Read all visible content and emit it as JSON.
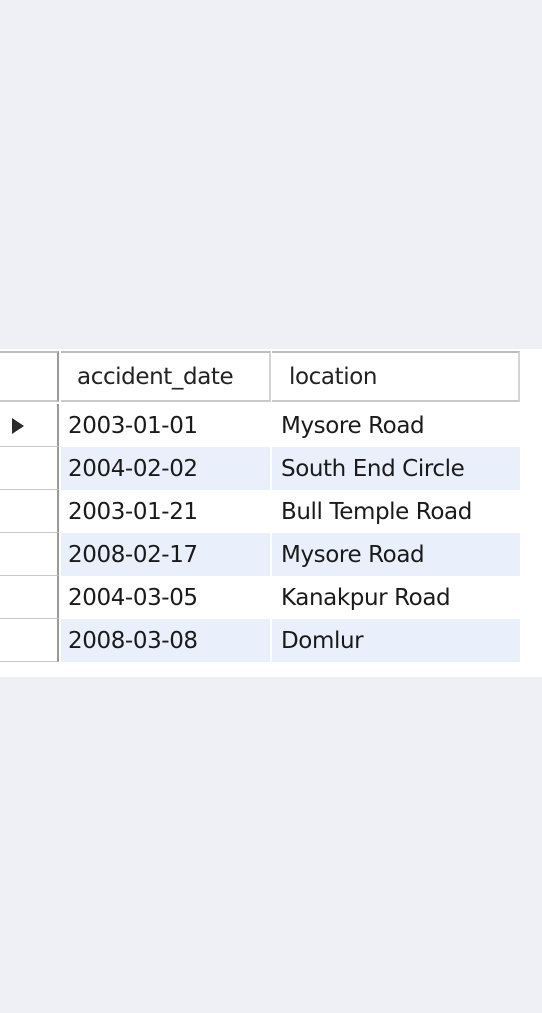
{
  "result_grid": {
    "columns": [
      "accident_date",
      "location"
    ],
    "rows": [
      {
        "accident_date": "2003-01-01",
        "location": "Mysore Road"
      },
      {
        "accident_date": "2004-02-02",
        "location": "South End Circle"
      },
      {
        "accident_date": "2003-01-21",
        "location": "Bull Temple Road"
      },
      {
        "accident_date": "2008-02-17",
        "location": "Mysore Road"
      },
      {
        "accident_date": "2004-03-05",
        "location": "Kanakpur Road"
      },
      {
        "accident_date": "2008-03-08",
        "location": "Domlur"
      }
    ],
    "current_row_icon": "row-pointer-icon"
  }
}
